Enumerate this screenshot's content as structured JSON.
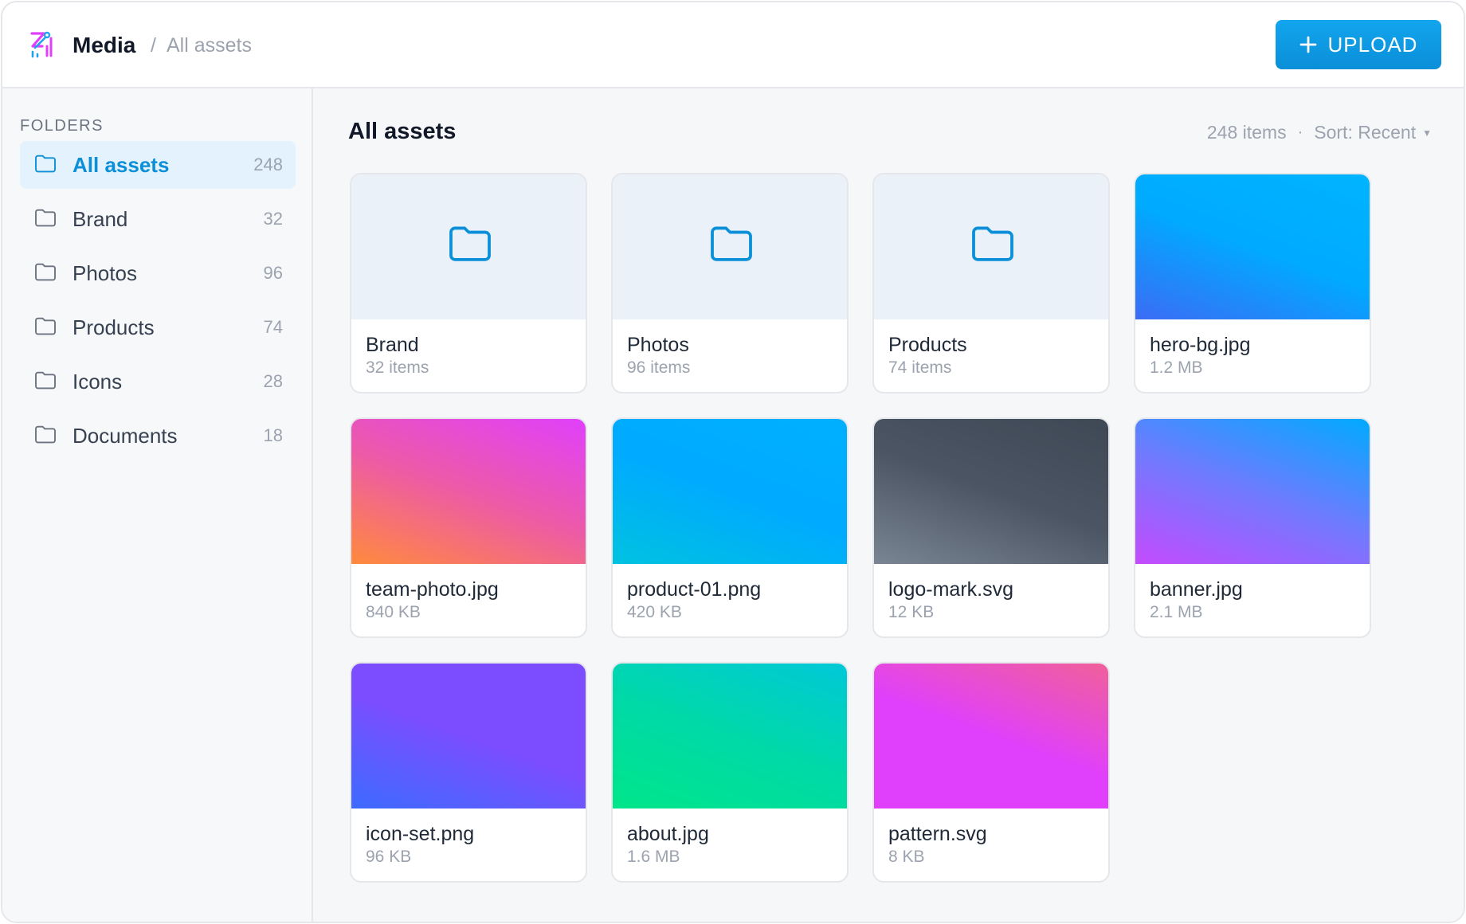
{
  "header": {
    "app_title": "Media",
    "breadcrumb_separator": "/",
    "breadcrumb_current": "All assets",
    "upload_label": "UPLOAD",
    "upload_color": "#0a8fd8"
  },
  "sidebar": {
    "heading": "FOLDERS",
    "items": [
      {
        "label": "All assets",
        "count": "248",
        "active": true,
        "icon": "folder-icon"
      },
      {
        "label": "Brand",
        "count": "32",
        "icon": "folder-icon"
      },
      {
        "label": "Photos",
        "count": "96",
        "icon": "folder-icon"
      },
      {
        "label": "Products",
        "count": "74",
        "icon": "folder-icon"
      },
      {
        "label": "Icons",
        "count": "28",
        "icon": "folder-icon"
      },
      {
        "label": "Documents",
        "count": "18",
        "icon": "folder-icon"
      }
    ]
  },
  "main": {
    "title": "All assets",
    "item_count": "248 items",
    "meta_separator": "·",
    "sort_label": "Sort: Recent",
    "cards": [
      {
        "type": "folder",
        "name": "Brand",
        "meta": "32 items"
      },
      {
        "type": "folder",
        "name": "Photos",
        "meta": "96 items"
      },
      {
        "type": "folder",
        "name": "Products",
        "meta": "74 items"
      },
      {
        "type": "file",
        "name": "hero-bg.jpg",
        "meta": "1.2 MB",
        "gradient": [
          "#3b6cf5",
          "#00aaff",
          "#00b4ff"
        ]
      },
      {
        "type": "file",
        "name": "team-photo.jpg",
        "meta": "840 KB",
        "gradient": [
          "#ff8a3d",
          "#ec5aa8",
          "#e040fb"
        ]
      },
      {
        "type": "file",
        "name": "product-01.png",
        "meta": "420 KB",
        "gradient": [
          "#00c2e0",
          "#00aaff",
          "#00b0ff"
        ]
      },
      {
        "type": "file",
        "name": "logo-mark.svg",
        "meta": "12 KB",
        "gradient": [
          "#7a8594",
          "#4b5563",
          "#3f4855"
        ]
      },
      {
        "type": "file",
        "name": "banner.jpg",
        "meta": "2.1 MB",
        "gradient": [
          "#c44bff",
          "#6f7bff",
          "#00aaff"
        ]
      },
      {
        "type": "file",
        "name": "icon-set.png",
        "meta": "96 KB",
        "gradient": [
          "#3d6bff",
          "#7b4dff",
          "#7c4dff"
        ]
      },
      {
        "type": "file",
        "name": "about.jpg",
        "meta": "1.6 MB",
        "gradient": [
          "#00e68a",
          "#00d9a8",
          "#00c8d8"
        ]
      },
      {
        "type": "file",
        "name": "pattern.svg",
        "meta": "8 KB",
        "gradient": [
          "#e040fb",
          "#e040fb",
          "#f0609a"
        ]
      }
    ]
  }
}
